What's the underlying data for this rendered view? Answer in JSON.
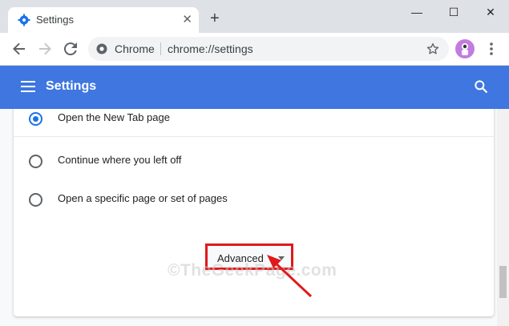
{
  "tab": {
    "title": "Settings",
    "close": "✕"
  },
  "new_tab": "+",
  "window_controls": {
    "minimize": "—",
    "maximize": "☐",
    "close": "✕"
  },
  "omnibox": {
    "site_label": "Chrome",
    "url": "chrome://settings"
  },
  "header": {
    "title": "Settings"
  },
  "startup_options": [
    {
      "label": "Open the New Tab page",
      "checked": true
    },
    {
      "label": "Continue where you left off",
      "checked": false
    },
    {
      "label": "Open a specific page or set of pages",
      "checked": false
    }
  ],
  "advanced": {
    "label": "Advanced"
  },
  "watermark": "©TheGeekPage.com",
  "colors": {
    "accent": "#3f76e0",
    "highlight": "#e0191b",
    "radio_checked": "#1a73e8"
  },
  "scroll_position": 0.85
}
